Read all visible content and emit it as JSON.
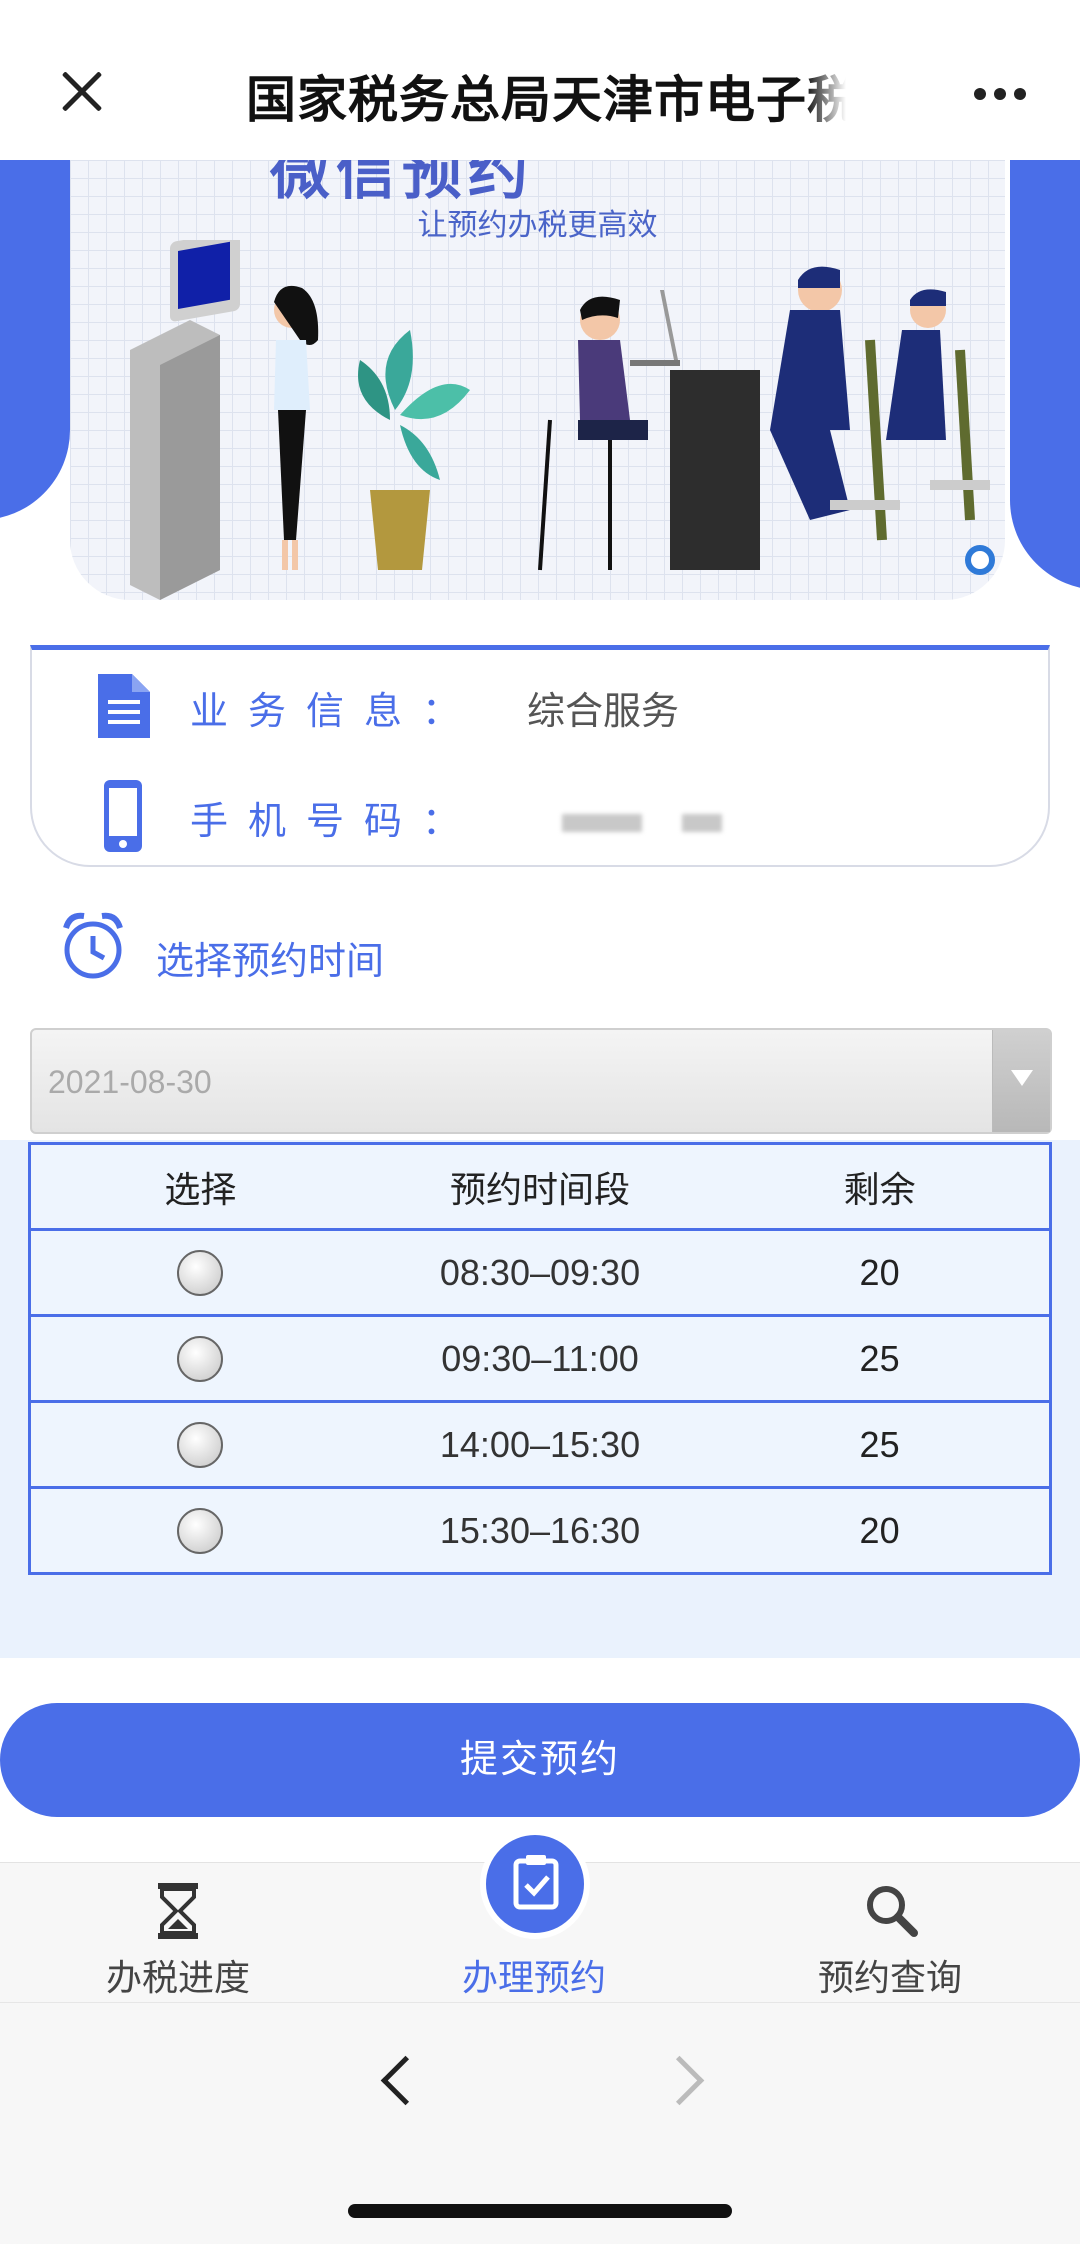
{
  "header": {
    "title": "国家税务总局天津市电子税"
  },
  "banner": {
    "heading": "微信预约",
    "subtitle": "让预约办税更高效"
  },
  "info": {
    "business_label": "业务信息：",
    "business_value": "综合服务",
    "phone_label": "手机号码："
  },
  "appointment": {
    "choose_label": "选择预约时间",
    "date_value": "2021-08-30"
  },
  "table": {
    "headers": [
      "选择",
      "预约时间段",
      "剩余"
    ],
    "rows": [
      {
        "time": "08:30–09:30",
        "remaining": "20"
      },
      {
        "time": "09:30–11:00",
        "remaining": "25"
      },
      {
        "time": "14:00–15:30",
        "remaining": "25"
      },
      {
        "time": "15:30–16:30",
        "remaining": "20"
      }
    ]
  },
  "submit_label": "提交预约",
  "tabs": [
    {
      "label": "办税进度",
      "icon": "hourglass-icon",
      "active": false
    },
    {
      "label": "办理预约",
      "icon": "clipboard-check-icon",
      "active": true
    },
    {
      "label": "预约查询",
      "icon": "search-icon",
      "active": false
    }
  ],
  "colors": {
    "accent": "#4a6ee8",
    "table_bg": "#eaf2fd"
  }
}
